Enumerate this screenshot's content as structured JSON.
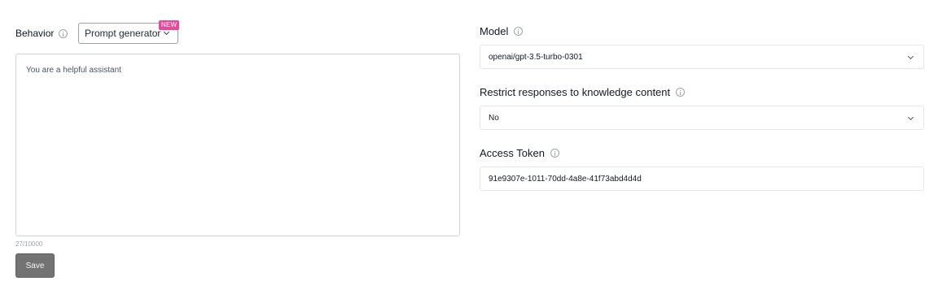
{
  "behavior": {
    "label": "Behavior",
    "prompt_button_label": "Prompt generator",
    "new_badge": "NEW",
    "prompt_text": "You are a helpful assistant",
    "char_count": "27/10000",
    "save_label": "Save"
  },
  "model": {
    "label": "Model",
    "value": "openai/gpt-3.5-turbo-0301"
  },
  "restrict": {
    "label": "Restrict responses to knowledge content",
    "value": "No"
  },
  "access_token": {
    "label": "Access Token",
    "value": "91e9307e-1011-70dd-4a8e-41f73abd4d4d"
  },
  "icons": [
    "info-icon",
    "chevron-down-icon"
  ]
}
